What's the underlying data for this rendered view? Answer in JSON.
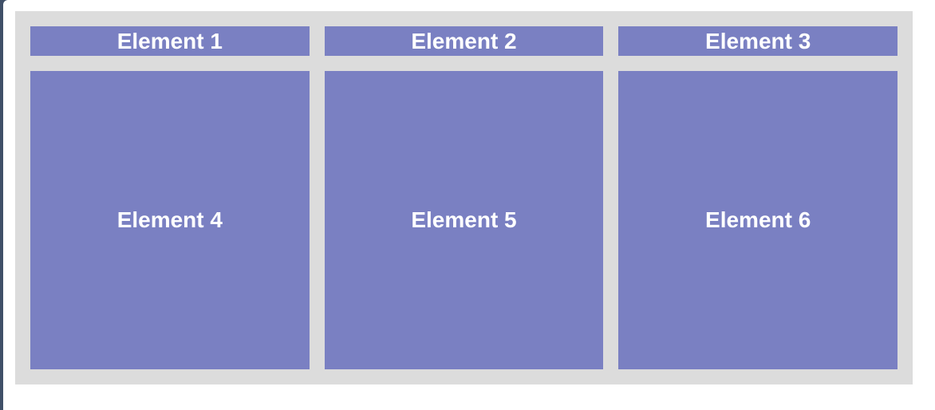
{
  "grid": {
    "items": [
      {
        "label": "Element 1"
      },
      {
        "label": "Element 2"
      },
      {
        "label": "Element 3"
      },
      {
        "label": "Element 4"
      },
      {
        "label": "Element 5"
      },
      {
        "label": "Element 6"
      }
    ]
  },
  "colors": {
    "item_background": "#7a80c2",
    "container_background": "#dcdcdc",
    "text": "#ffffff",
    "frame": "#3f5068"
  }
}
